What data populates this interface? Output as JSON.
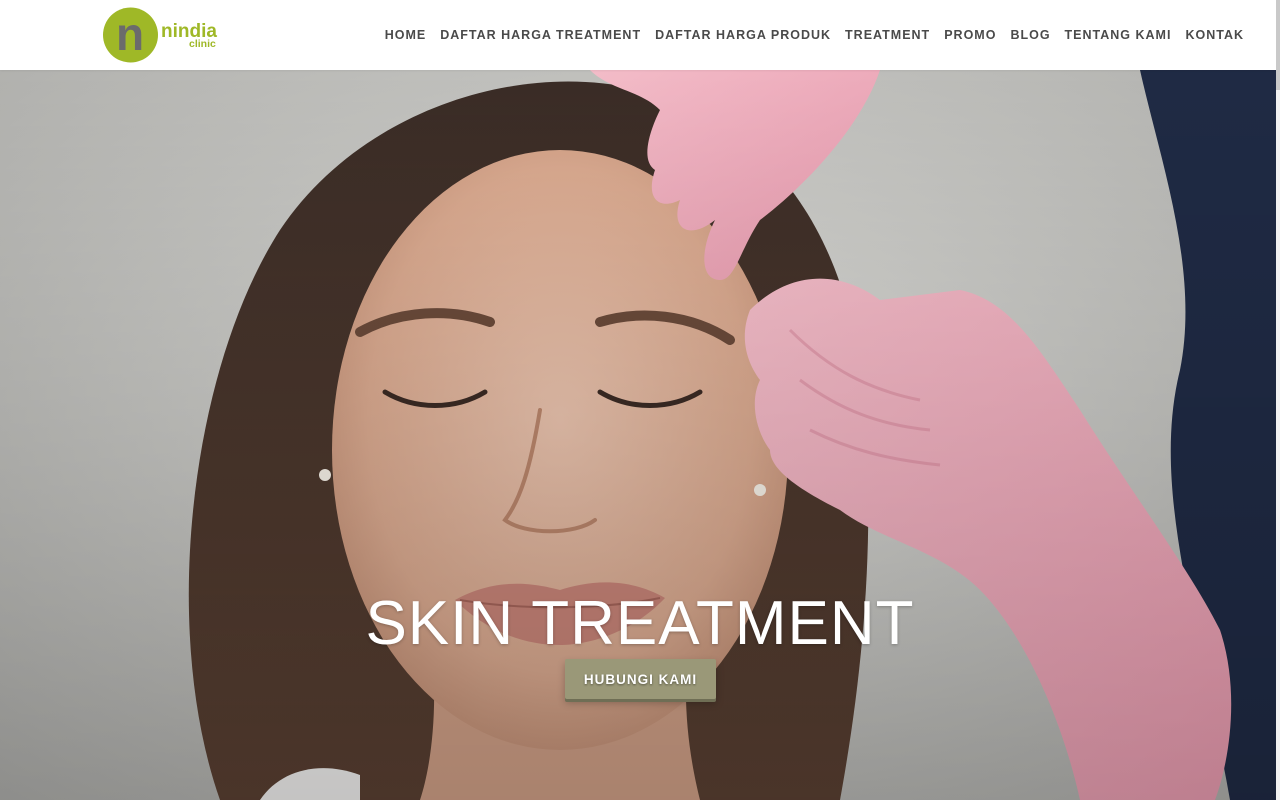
{
  "logo": {
    "initial": "n",
    "name": "nindia",
    "sub": "clinic",
    "brand_color": "#9fb827",
    "ring_color": "#8aa31e",
    "letter_color": "#6b6b6b"
  },
  "nav": {
    "items": [
      {
        "label": "HOME"
      },
      {
        "label": "DAFTAR HARGA TREATMENT"
      },
      {
        "label": "DAFTAR HARGA PRODUK"
      },
      {
        "label": "TREATMENT"
      },
      {
        "label": "PROMO"
      },
      {
        "label": "BLOG"
      },
      {
        "label": "TENTANG KAMI"
      },
      {
        "label": "KONTAK"
      }
    ]
  },
  "hero": {
    "title": "SKIN TREATMENT",
    "cta_label": "HUBUNGI KAMI",
    "cta_color": "#9a9878"
  }
}
